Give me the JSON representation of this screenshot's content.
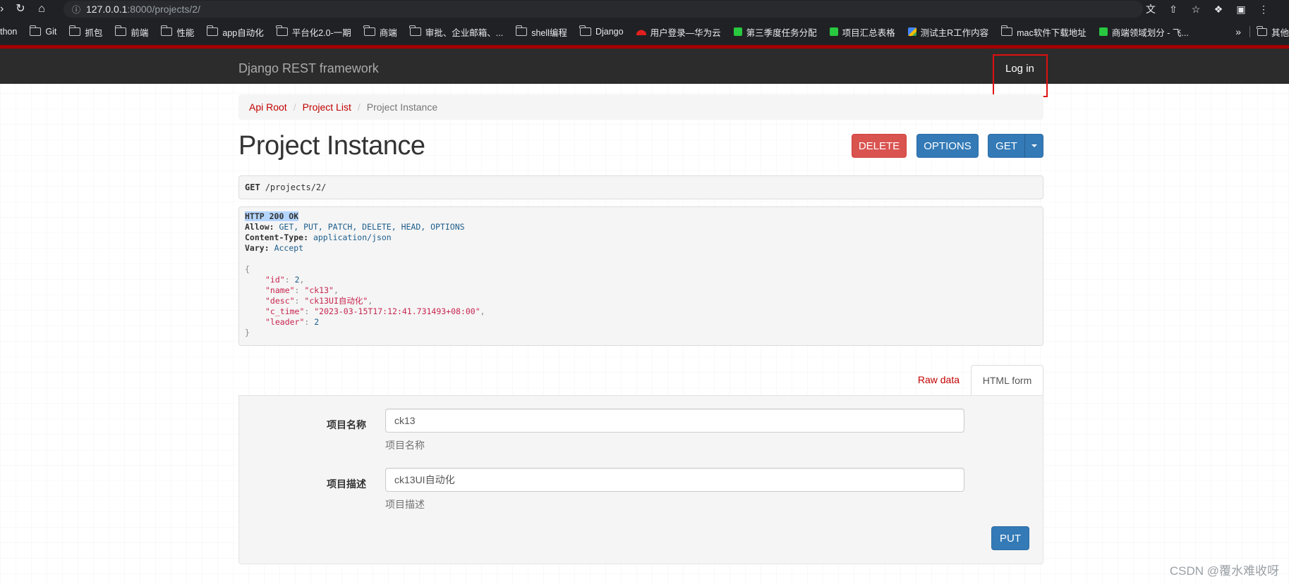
{
  "browser": {
    "url_host": "127.0.0.1",
    "url_path": ":8000/projects/2/",
    "bookmarks": [
      {
        "label": "thon",
        "icon": "none"
      },
      {
        "label": "Git",
        "icon": "folder-icon"
      },
      {
        "label": "抓包",
        "icon": "folder-icon"
      },
      {
        "label": "前端",
        "icon": "folder-icon"
      },
      {
        "label": "性能",
        "icon": "folder-icon"
      },
      {
        "label": "app自动化",
        "icon": "folder-icon"
      },
      {
        "label": "平台化2.0-一期",
        "icon": "folder-icon"
      },
      {
        "label": "商端",
        "icon": "folder-icon"
      },
      {
        "label": "审批、企业邮箱、...",
        "icon": "folder-icon"
      },
      {
        "label": "shell编程",
        "icon": "folder-icon"
      },
      {
        "label": "Django",
        "icon": "folder-icon"
      },
      {
        "label": "用户登录—华为云",
        "icon": "huawei-icon"
      },
      {
        "label": "第三季度任务分配",
        "icon": "sheet-icon"
      },
      {
        "label": "项目汇总表格",
        "icon": "sheet-icon"
      },
      {
        "label": "测试主R工作内容",
        "icon": "doc-icon"
      },
      {
        "label": "mac软件下载地址",
        "icon": "folder-icon"
      },
      {
        "label": "商端领域划分 - 飞...",
        "icon": "sheet-icon"
      }
    ],
    "more_label": "»",
    "other_bookmarks": "其他"
  },
  "navbar": {
    "brand": "Django REST framework",
    "login": "Log in"
  },
  "breadcrumb": {
    "items": [
      "Api Root",
      "Project List"
    ],
    "active": "Project Instance",
    "separator": "/"
  },
  "page": {
    "title": "Project Instance"
  },
  "buttons": {
    "delete": "DELETE",
    "options": "OPTIONS",
    "get": "GET",
    "put": "PUT"
  },
  "request": {
    "method": "GET",
    "path": "/projects/2/"
  },
  "response": {
    "status": "HTTP 200 OK",
    "headers": [
      {
        "name": "Allow:",
        "value": "GET, PUT, PATCH, DELETE, HEAD, OPTIONS"
      },
      {
        "name": "Content-Type:",
        "value": "application/json"
      },
      {
        "name": "Vary:",
        "value": "Accept"
      }
    ],
    "open_brace": "{",
    "close_brace": "}",
    "body": [
      {
        "key": "\"id\"",
        "value": "2",
        "type": "num"
      },
      {
        "key": "\"name\"",
        "value": "\"ck13\"",
        "type": "str"
      },
      {
        "key": "\"desc\"",
        "value": "\"ck13UI自动化\"",
        "type": "str"
      },
      {
        "key": "\"c_time\"",
        "value": "\"2023-03-15T17:12:41.731493+08:00\"",
        "type": "str"
      },
      {
        "key": "\"leader\"",
        "value": "2",
        "type": "num"
      }
    ]
  },
  "tabs": {
    "raw": "Raw data",
    "html": "HTML form"
  },
  "form": {
    "name_label": "项目名称",
    "name_value": "ck13",
    "name_help": "项目名称",
    "desc_label": "项目描述",
    "desc_value": "ck13UI自动化",
    "desc_help": "项目描述"
  },
  "watermark": "CSDN @覆水难收呀",
  "colors": {
    "brand_red": "#a30000",
    "link_red": "#c20000",
    "primary": "#337ab7",
    "danger": "#d9534f",
    "navbar_bg": "#2c2c2c"
  }
}
